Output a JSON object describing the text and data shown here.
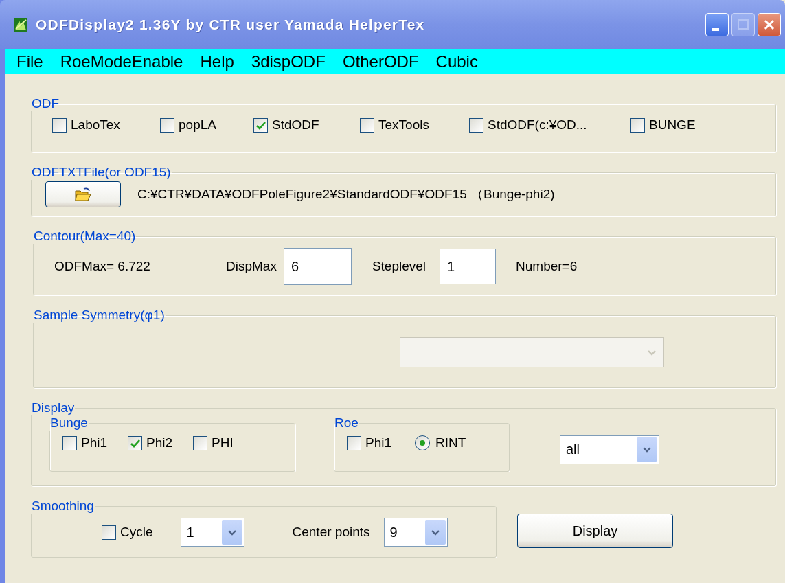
{
  "window": {
    "title": "ODFDisplay2 1.36Y by CTR user Yamada HelperTex"
  },
  "menu": [
    "File",
    "RoeModeEnable",
    "Help",
    "3dispODF",
    "OtherODF",
    "Cubic"
  ],
  "odf_group": {
    "title": "ODF",
    "options": [
      {
        "label": "LaboTex",
        "checked": false
      },
      {
        "label": "popLA",
        "checked": false
      },
      {
        "label": "StdODF",
        "checked": true
      },
      {
        "label": "TexTools",
        "checked": false
      },
      {
        "label": "StdODF(c:¥OD...",
        "checked": false
      },
      {
        "label": "BUNGE",
        "checked": false
      }
    ]
  },
  "file_group": {
    "title": "ODFTXTFile(or ODF15)",
    "path": "C:¥CTR¥DATA¥ODFPoleFigure2¥StandardODF¥ODF15 （Bunge-phi2)"
  },
  "contour_group": {
    "title": "Contour(Max=40)",
    "odf_max": "ODFMax= 6.722",
    "fields": [
      {
        "label": "DispMax",
        "value": "6"
      },
      {
        "label": "Steplevel",
        "value": "1"
      }
    ],
    "number": "Number=6"
  },
  "symmetry_group": {
    "title": "Sample Symmetry(φ1)",
    "dropdown": {
      "disabled": true
    }
  },
  "display_group": {
    "title": "Display",
    "bunge": {
      "title": "Bunge",
      "options": [
        {
          "label": "Phi1",
          "checked": false
        },
        {
          "label": "Phi2",
          "checked": true
        },
        {
          "label": "PHI",
          "checked": false
        }
      ]
    },
    "roe": {
      "title": "Roe",
      "options": [
        {
          "kind": "checkbox",
          "label": "Phi1",
          "checked": false
        },
        {
          "kind": "radio",
          "label": "RINT",
          "checked": true
        }
      ]
    },
    "dropdown": {
      "value": "all"
    }
  },
  "smoothing_group": {
    "title": "Smoothing",
    "cycle": {
      "label": "Cycle",
      "checked": false
    },
    "cycle_dropdown": {
      "value": "1"
    },
    "center_label": "Center points",
    "center_dropdown": {
      "value": "9"
    }
  },
  "display_button": "Display"
}
